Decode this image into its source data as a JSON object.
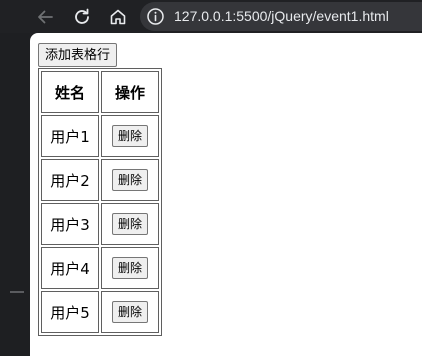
{
  "browser": {
    "url": "127.0.0.1:5500/jQuery/event1.html",
    "icons": {
      "back": "arrow-left-icon",
      "reload": "reload-icon",
      "home": "home-icon",
      "site_info": "info-icon"
    }
  },
  "page": {
    "add_row_label": "添加表格行",
    "table": {
      "headers": [
        "姓名",
        "操作"
      ],
      "rows": [
        {
          "name": "用户1",
          "action": "删除"
        },
        {
          "name": "用户2",
          "action": "删除"
        },
        {
          "name": "用户3",
          "action": "删除"
        },
        {
          "name": "用户4",
          "action": "删除"
        },
        {
          "name": "用户5",
          "action": "删除"
        }
      ]
    }
  },
  "colors": {
    "chrome_bg": "#202124",
    "omnibox_bg": "#35363a",
    "page_bg": "#ffffff",
    "border": "#5f5f5f",
    "button_bg": "#efefef"
  }
}
